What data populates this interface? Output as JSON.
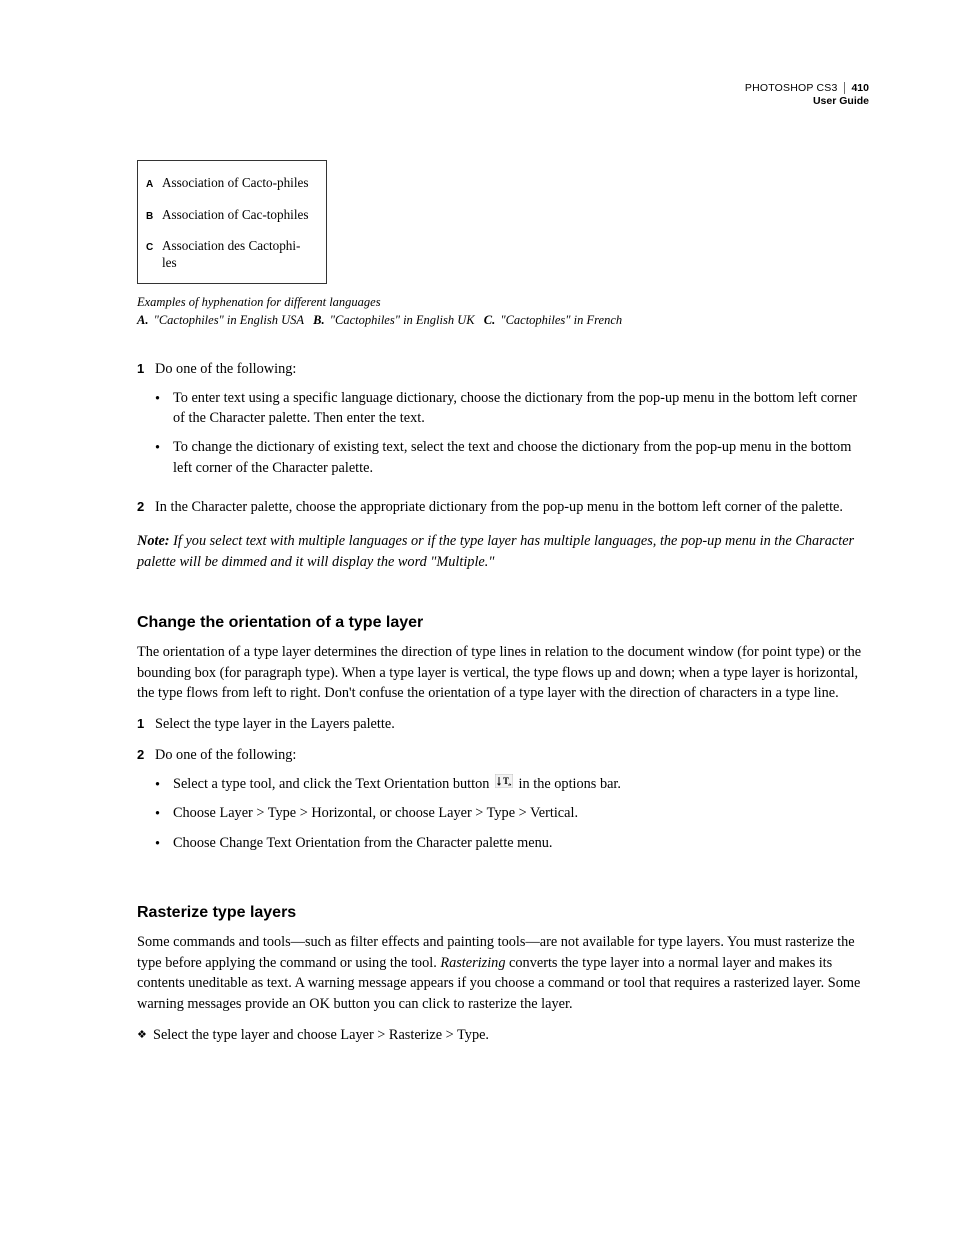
{
  "header": {
    "product": "PHOTOSHOP CS3",
    "guide": "User Guide",
    "page": "410"
  },
  "example": {
    "a_label": "A",
    "a_text": "Association of Cacto-philes",
    "b_label": "B",
    "b_text": "Association of Cac-tophiles",
    "c_label": "C",
    "c_text": "Association des Cactophi-les"
  },
  "caption": {
    "line1": "Examples of hyphenation for different languages",
    "a_lbl": "A.",
    "a_txt": "\"Cactophiles\" in English USA",
    "b_lbl": "B.",
    "b_txt": "\"Cactophiles\" in English UK",
    "c_lbl": "C.",
    "c_txt": "\"Cactophiles\" in French"
  },
  "steps1": {
    "n1": "1",
    "t1": "Do one of the following:",
    "b1": "To enter text using a specific language dictionary, choose the dictionary from the pop-up menu in the bottom left corner of the Character palette. Then enter the text.",
    "b2": "To change the dictionary of existing text, select the text and choose the dictionary from the pop-up menu in the bottom left corner of the Character palette.",
    "n2": "2",
    "t2": "In the Character palette, choose the appropriate dictionary from the pop-up menu in the bottom left corner of the palette."
  },
  "note1": {
    "label": "Note:",
    "text": "If you select text with multiple languages or if the type layer has multiple languages, the pop-up menu in the Character palette will be dimmed and it will display the word \"Multiple.\""
  },
  "section2": {
    "title": "Change the orientation of a type layer",
    "intro": "The orientation of a type layer determines the direction of type lines in relation to the document window (for point type) or the bounding box (for paragraph type). When a type layer is vertical, the type flows up and down; when a type layer is horizontal, the type flows from left to right. Don't confuse the orientation of a type layer with the direction of characters in a type line.",
    "n1": "1",
    "t1": "Select the type layer in the Layers palette.",
    "n2": "2",
    "t2": "Do one of the following:",
    "b1a": "Select a type tool, and click the Text Orientation button",
    "b1b": "in the options bar.",
    "b2": "Choose Layer > Type > Horizontal, or choose Layer > Type > Vertical.",
    "b3": "Choose Change Text Orientation from the Character palette menu."
  },
  "section3": {
    "title": "Rasterize type layers",
    "p1a": "Some commands and tools—such as filter effects and painting tools—are not available for type layers. You must rasterize the type before applying the command or using the tool. ",
    "p1_em": "Rasterizing",
    "p1b": " converts the type layer into a normal layer and makes its contents uneditable as text. A warning message appears if you choose a command or tool that requires a rasterized layer. Some warning messages provide an OK button you can click to rasterize the layer.",
    "d1": "Select the type layer and choose Layer > Rasterize > Type."
  }
}
